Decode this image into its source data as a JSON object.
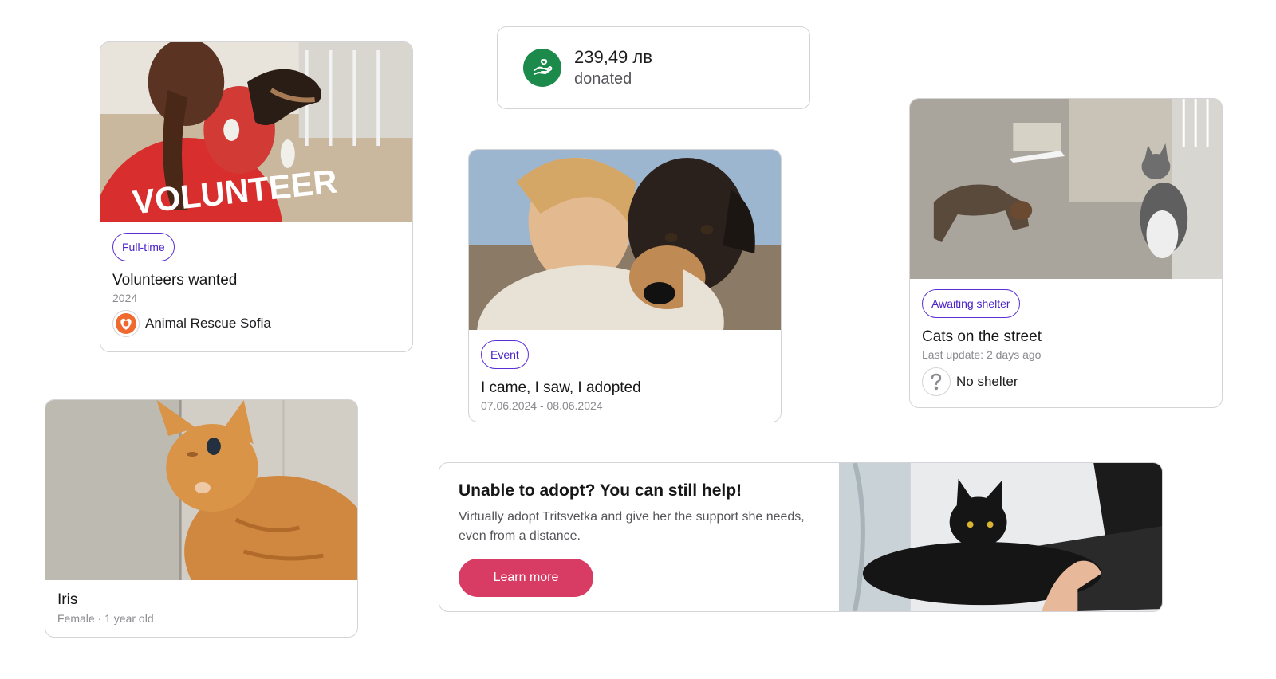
{
  "volunteer_card": {
    "tag": "Full-time",
    "title": "Volunteers wanted",
    "year": "2024",
    "org_name": "Animal Rescue Sofia",
    "org_logo_icon": "heart-paw-icon",
    "photo_text": "VOLUNTEER"
  },
  "donation_card": {
    "amount": "239,49 лв",
    "label": "donated",
    "icon": "hand-heart-icon",
    "icon_color": "#1c8a4b"
  },
  "event_card": {
    "tag": "Event",
    "title": "I came, I saw, I adopted",
    "dates": "07.06.2024 - 08.06.2024"
  },
  "street_card": {
    "tag": "Awaiting shelter",
    "title": "Cats on the street",
    "updated": "Last update: 2 days ago",
    "shelter_icon": "question-mark-icon",
    "shelter_label": "No shelter"
  },
  "pet_card": {
    "name": "Iris",
    "details": "Female · 1 year old"
  },
  "promo_card": {
    "title": "Unable to adopt? You can still help!",
    "description": "Virtually adopt Tritsvetka and give her the support she needs, even from a distance.",
    "button_label": "Learn more",
    "button_color": "#d83b63"
  },
  "colors": {
    "tag_border": "#5b2fd6",
    "card_border": "#d4d4d8"
  }
}
